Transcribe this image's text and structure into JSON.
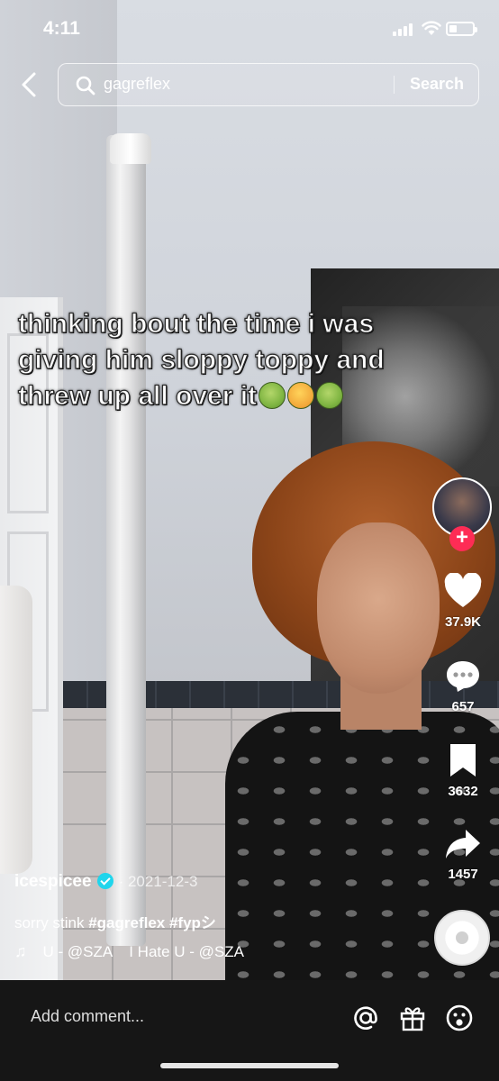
{
  "status_bar": {
    "time": "4:11",
    "battery_level": 0.35
  },
  "search": {
    "query": "gagreflex",
    "button_label": "Search"
  },
  "caption": {
    "lines": [
      "thinking bout the time i was",
      "giving him sloppy toppy and",
      "threw up all over it"
    ],
    "emojis": [
      "nauseated-face-icon",
      "vomiting-face-icon",
      "nauseated-face-icon"
    ]
  },
  "actions": {
    "likes": "37.9K",
    "comments": "657",
    "saves": "3632",
    "shares": "1457"
  },
  "post": {
    "username": "icespicee",
    "date": "· 2021-12-3",
    "description_prefix": "sorry stink",
    "hashtags": "#gagreflex #fypシ",
    "music_1": "U - @SZA",
    "music_2": "I Hate U - @SZA"
  },
  "comment_bar": {
    "placeholder": "Add comment..."
  },
  "colors": {
    "accent": "#fe2c55",
    "verified": "#20d5ec",
    "bottom_bar": "#161616"
  }
}
